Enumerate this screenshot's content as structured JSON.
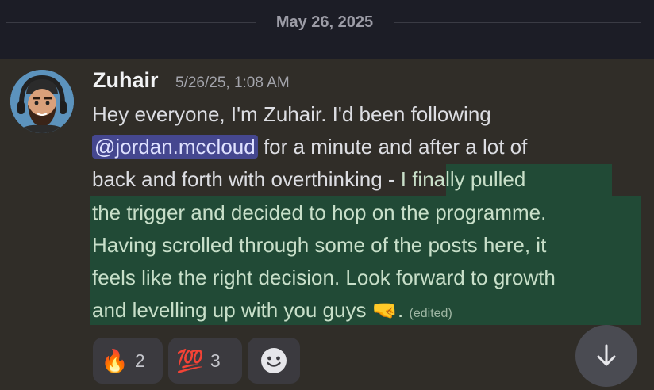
{
  "date_divider": {
    "label": "May 26, 2025"
  },
  "message": {
    "author": "Zuhair",
    "timestamp": "5/26/25, 1:08 AM",
    "lines": [
      {
        "text": "Hey everyone, I'm Zuhair. I'd been following"
      },
      {
        "mention": "@jordan.mccloud",
        "after": " for a minute and after a lot of"
      },
      {
        "before": "back and forth with overthinking - ",
        "highlighted": "I finally pulled"
      },
      {
        "text": "the trigger and decided to hop on the programme."
      },
      {
        "text": "Having scrolled through some of the posts here, it"
      },
      {
        "text": "feels like the right decision. Look forward to growth"
      },
      {
        "text": "and levelling up with you guys 🤜",
        "suffix": ".",
        "edited": "(edited)"
      }
    ]
  },
  "reactions": [
    {
      "emoji": "🔥",
      "name": "fire",
      "count": "2"
    },
    {
      "emoji": "💯",
      "name": "hundred",
      "count": "3"
    },
    {
      "name": "add-reaction"
    }
  ],
  "colors": {
    "message_background": "#302d28",
    "highlight": "#214a36",
    "mention_background": "#45478f"
  }
}
